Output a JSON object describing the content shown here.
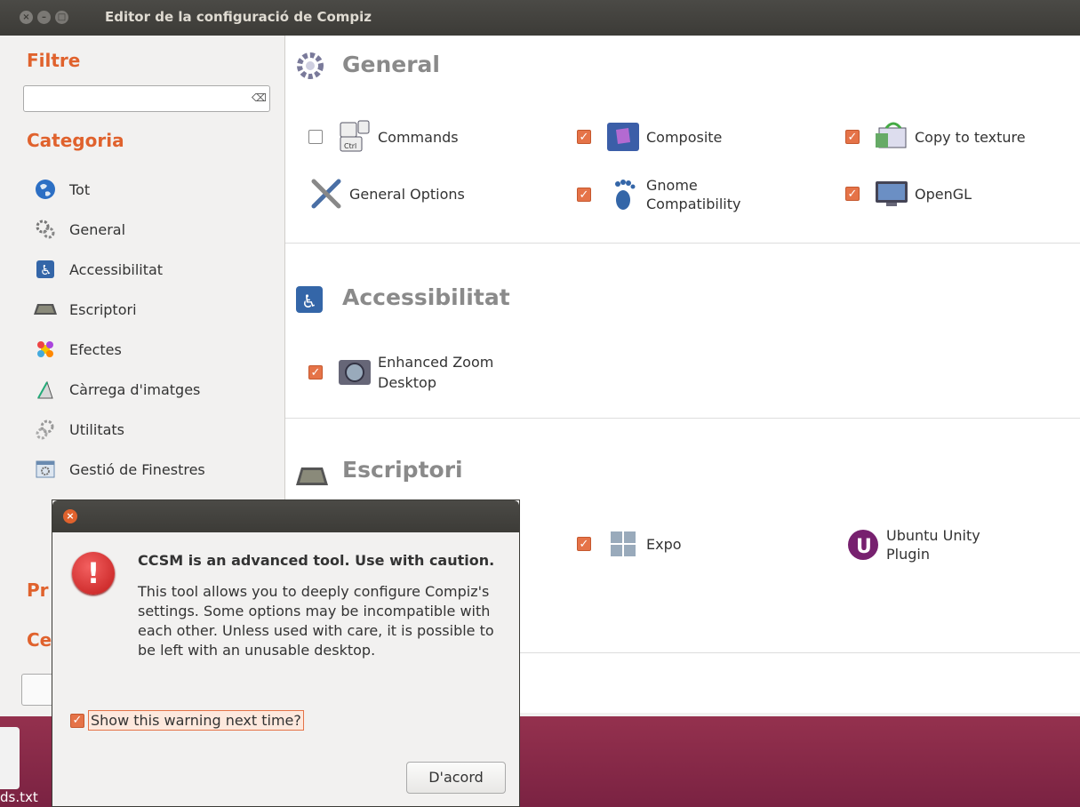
{
  "window": {
    "title": "Editor de la configuració de Compiz"
  },
  "sidebar": {
    "filter_heading": "Filtre",
    "filter_value": "",
    "category_heading": "Categoria",
    "categories": [
      {
        "label": "Tot",
        "icon": "globe-icon"
      },
      {
        "label": "General",
        "icon": "gears-icon"
      },
      {
        "label": "Accessibilitat",
        "icon": "accessibility-icon"
      },
      {
        "label": "Escriptori",
        "icon": "desktop-icon"
      },
      {
        "label": "Efectes",
        "icon": "effects-icon"
      },
      {
        "label": "Càrrega d'imatges",
        "icon": "image-loading-icon"
      },
      {
        "label": "Utilitats",
        "icon": "utilities-icon"
      },
      {
        "label": "Gestió de Finestres",
        "icon": "window-management-icon"
      }
    ],
    "partial_heading_1": "Pr",
    "partial_heading_2": "Ce"
  },
  "groups": {
    "general": {
      "title": "General",
      "plugins": [
        {
          "label": "Commands",
          "checked": false
        },
        {
          "label": "Composite",
          "checked": true
        },
        {
          "label": "Copy to texture",
          "checked": true
        },
        {
          "label": "General Options",
          "checked": null
        },
        {
          "label": "Gnome Compatibility",
          "checked": true
        },
        {
          "label": "OpenGL",
          "checked": true
        }
      ]
    },
    "accessibility": {
      "title": "Accessibilitat",
      "plugins": [
        {
          "label": "Enhanced Zoom Desktop",
          "checked": true
        }
      ]
    },
    "desktop": {
      "title": "Escriptori",
      "plugins": [
        {
          "label": "Expo",
          "checked": true
        },
        {
          "label": "Ubuntu Unity Plugin",
          "checked": null
        }
      ]
    }
  },
  "dialog": {
    "heading": "CCSM is an advanced tool. Use with caution.",
    "body": "This tool allows you to deeply configure Compiz's settings. Some options may be incompatible with each other. Unless used with care, it is possible to be left with an unusable desktop.",
    "checkbox_label": "Show this warning next time?",
    "checkbox_checked": true,
    "ok_label": "D'acord"
  },
  "desktop": {
    "file_label": "ds.txt"
  },
  "colors": {
    "accent": "#e0622d",
    "checkbox": "#e57348",
    "titlebar": "#3c3b37"
  }
}
